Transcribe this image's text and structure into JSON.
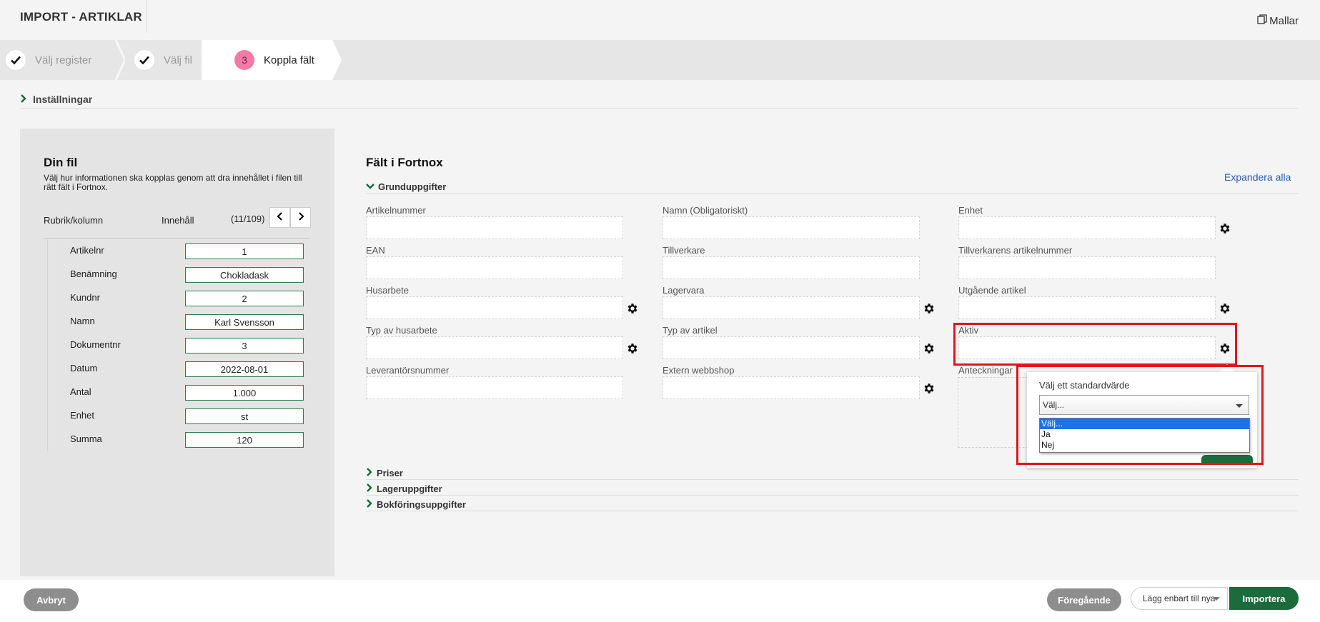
{
  "header": {
    "title": "IMPORT - ARTIKLAR",
    "templates_label": "Mallar"
  },
  "steps": [
    {
      "label": "Välj register",
      "state": "done"
    },
    {
      "label": "Välj fil",
      "state": "done"
    },
    {
      "number": "3",
      "label": "Koppla fält",
      "state": "active"
    }
  ],
  "settings": {
    "label": "Inställningar"
  },
  "left_panel": {
    "title": "Din fil",
    "description": "Välj hur informationen ska kopplas genom att dra innehållet i filen till rätt fält i Fortnox.",
    "col_header": "Rubrik/kolumn",
    "content_header": "Innehåll",
    "row_counter": "(11/109)",
    "rows": [
      {
        "name": "Artikelnr",
        "value": "1"
      },
      {
        "name": "Benämning",
        "value": "Chokladask"
      },
      {
        "name": "Kundnr",
        "value": "2"
      },
      {
        "name": "Namn",
        "value": "Karl Svensson"
      },
      {
        "name": "Dokumentnr",
        "value": "3"
      },
      {
        "name": "Datum",
        "value": "2022-08-01"
      },
      {
        "name": "Antal",
        "value": "1.000"
      },
      {
        "name": "Enhet",
        "value": "st"
      },
      {
        "name": "Summa",
        "value": "120"
      }
    ]
  },
  "right_panel": {
    "title": "Fält i Fortnox",
    "expand_all": "Expandera alla",
    "groups": [
      "Grunduppgifter",
      "Priser",
      "Lageruppgifter",
      "Bokföringsuppgifter"
    ],
    "fields": {
      "artikelnummer": "Artikelnummer",
      "namn": "Namn (Obligatoriskt)",
      "enhet": "Enhet",
      "ean": "EAN",
      "tillverkare": "Tillverkare",
      "tillverkarens_artikelnummer": "Tillverkarens artikelnummer",
      "husarbete": "Husarbete",
      "lagervara": "Lagervara",
      "utgaende_artikel": "Utgående artikel",
      "typ_av_husarbete": "Typ av husarbete",
      "typ_av_artikel": "Typ av artikel",
      "aktiv": "Aktiv",
      "leverantorsnummer": "Leverantörsnummer",
      "extern_webbshop": "Extern webbshop",
      "anteckningar": "Anteckningar"
    }
  },
  "popup": {
    "label": "Välj ett standardvärde",
    "selected": "Välj...",
    "options": [
      "Välj...",
      "Ja",
      "Nej"
    ]
  },
  "footer": {
    "cancel": "Avbryt",
    "previous": "Föregående",
    "mode": "Lägg enbart till nya",
    "import": "Importera"
  },
  "colors": {
    "brand_green": "#1b6b3c",
    "step_pink": "#f27ba6",
    "highlight_red": "#e2141f",
    "link_blue": "#2a5db0"
  }
}
